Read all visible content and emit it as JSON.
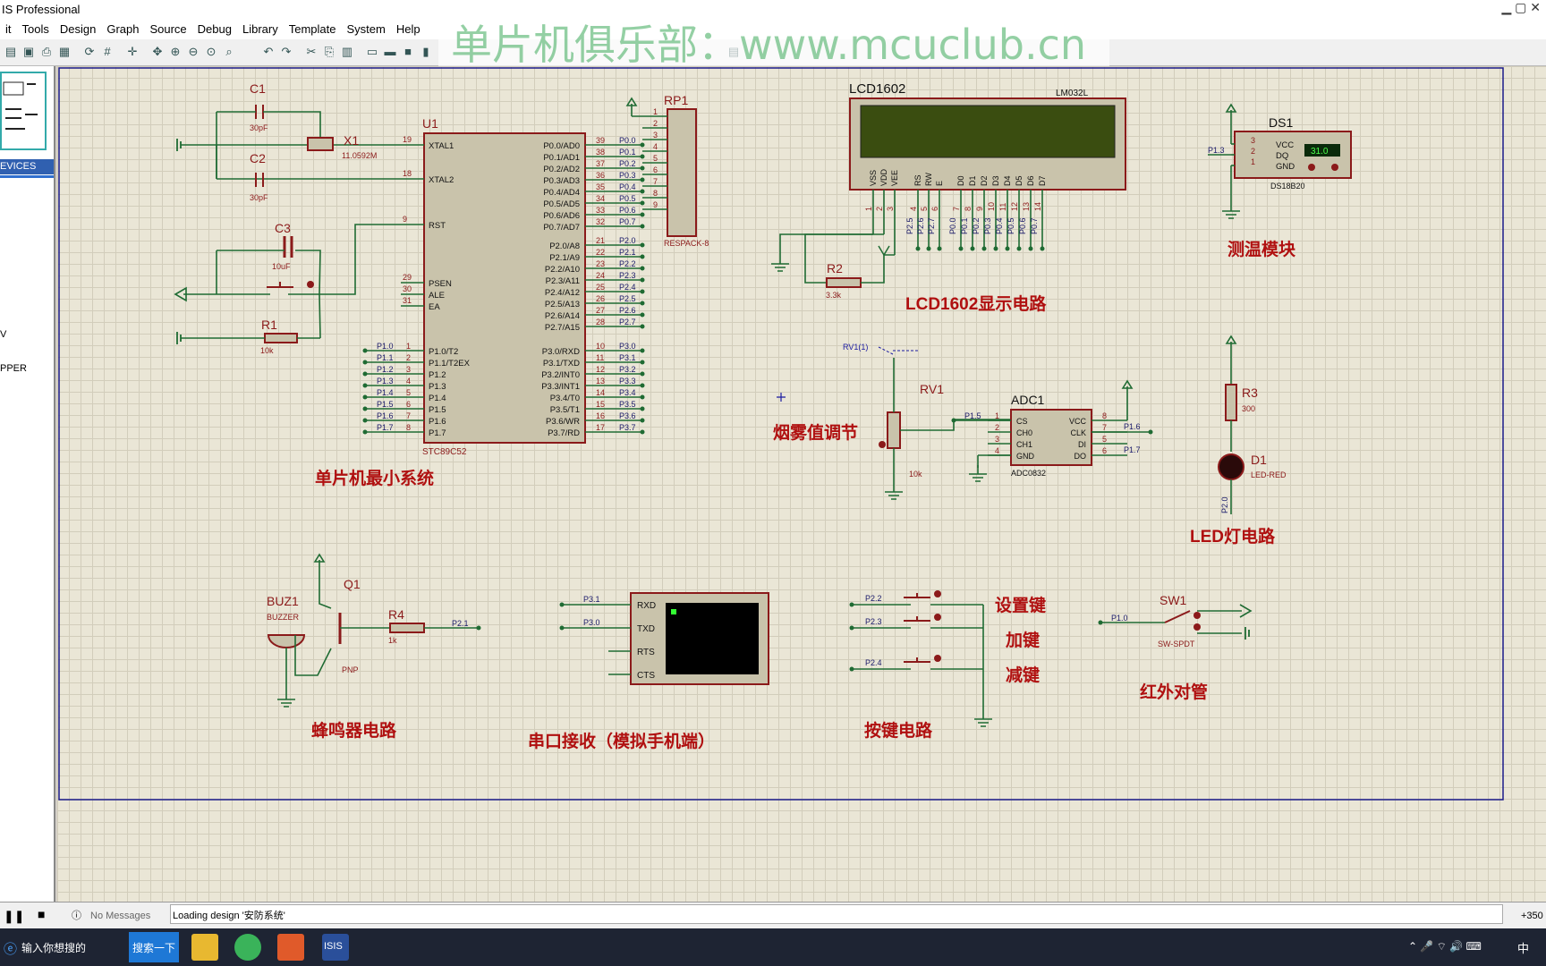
{
  "window": {
    "title": "IS Professional"
  },
  "menu": [
    "it",
    "Tools",
    "Design",
    "Graph",
    "Source",
    "Debug",
    "Library",
    "Template",
    "System",
    "Help"
  ],
  "watermark": "单片机俱乐部：www.mcuclub.cn",
  "sidebar": {
    "label_devices": "EVICES",
    "item_v": "V",
    "item_pper": "PPER"
  },
  "schematic": {
    "u1": "U1",
    "u1_part": "STC89C52",
    "u1_left_pins": [
      {
        "n": "19",
        "name": "XTAL1"
      },
      {
        "n": "18",
        "name": "XTAL2"
      },
      {
        "n": "9",
        "name": "RST"
      },
      {
        "n": "29",
        "name": "PSEN"
      },
      {
        "n": "30",
        "name": "ALE"
      },
      {
        "n": "31",
        "name": "EA"
      }
    ],
    "u1_p1_pins": [
      {
        "n": "1",
        "net": "P1.0",
        "name": "P1.0/T2"
      },
      {
        "n": "2",
        "net": "P1.1",
        "name": "P1.1/T2EX"
      },
      {
        "n": "3",
        "net": "P1.2",
        "name": "P1.2"
      },
      {
        "n": "4",
        "net": "P1.3",
        "name": "P1.3"
      },
      {
        "n": "5",
        "net": "P1.4",
        "name": "P1.4"
      },
      {
        "n": "6",
        "net": "P1.5",
        "name": "P1.5"
      },
      {
        "n": "7",
        "net": "P1.6",
        "name": "P1.6"
      },
      {
        "n": "8",
        "net": "P1.7",
        "name": "P1.7"
      }
    ],
    "u1_p0_pins": [
      {
        "n": "39",
        "name": "P0.0/AD0",
        "net": "P0.0"
      },
      {
        "n": "38",
        "name": "P0.1/AD1",
        "net": "P0.1"
      },
      {
        "n": "37",
        "name": "P0.2/AD2",
        "net": "P0.2"
      },
      {
        "n": "36",
        "name": "P0.3/AD3",
        "net": "P0.3"
      },
      {
        "n": "35",
        "name": "P0.4/AD4",
        "net": "P0.4"
      },
      {
        "n": "34",
        "name": "P0.5/AD5",
        "net": "P0.5"
      },
      {
        "n": "33",
        "name": "P0.6/AD6",
        "net": "P0.6"
      },
      {
        "n": "32",
        "name": "P0.7/AD7",
        "net": "P0.7"
      }
    ],
    "u1_p2_pins": [
      {
        "n": "21",
        "name": "P2.0/A8",
        "net": "P2.0"
      },
      {
        "n": "22",
        "name": "P2.1/A9",
        "net": "P2.1"
      },
      {
        "n": "23",
        "name": "P2.2/A10",
        "net": "P2.2"
      },
      {
        "n": "24",
        "name": "P2.3/A11",
        "net": "P2.3"
      },
      {
        "n": "25",
        "name": "P2.4/A12",
        "net": "P2.4"
      },
      {
        "n": "26",
        "name": "P2.5/A13",
        "net": "P2.5"
      },
      {
        "n": "27",
        "name": "P2.6/A14",
        "net": "P2.6"
      },
      {
        "n": "28",
        "name": "P2.7/A15",
        "net": "P2.7"
      }
    ],
    "u1_p3_pins": [
      {
        "n": "10",
        "name": "P3.0/RXD",
        "net": "P3.0"
      },
      {
        "n": "11",
        "name": "P3.1/TXD",
        "net": "P3.1"
      },
      {
        "n": "12",
        "name": "P3.2/INT0",
        "net": "P3.2"
      },
      {
        "n": "13",
        "name": "P3.3/INT1",
        "net": "P3.3"
      },
      {
        "n": "14",
        "name": "P3.4/T0",
        "net": "P3.4"
      },
      {
        "n": "15",
        "name": "P3.5/T1",
        "net": "P3.5"
      },
      {
        "n": "16",
        "name": "P3.6/WR",
        "net": "P3.6"
      },
      {
        "n": "17",
        "name": "P3.7/RD",
        "net": "P3.7"
      }
    ],
    "c1": "C1",
    "c1_val": "30pF",
    "c2": "C2",
    "c2_val": "30pF",
    "x1": "X1",
    "x1_val": "11.0592M",
    "c3": "C3",
    "c3_val": "10uF",
    "r1": "R1",
    "r1_val": "10k",
    "rp1": "RP1",
    "rp1_part": "RESPACK-8",
    "rp1_pins": [
      "1",
      "2",
      "3",
      "4",
      "5",
      "6",
      "7",
      "8",
      "9"
    ],
    "lcd": "LCD1602",
    "lcd_part": "LM032L",
    "lcd_pins": [
      "VSS",
      "VDD",
      "VEE",
      "RS",
      "RW",
      "E",
      "D0",
      "D1",
      "D2",
      "D3",
      "D4",
      "D5",
      "D6",
      "D7"
    ],
    "lcd_pin_nums": [
      "1",
      "2",
      "3",
      "4",
      "5",
      "6",
      "7",
      "8",
      "9",
      "10",
      "11",
      "12",
      "13",
      "14"
    ],
    "lcd_nets": [
      "P2.5",
      "P2.6",
      "P2.7",
      "P0.0",
      "P0.1",
      "P0.2",
      "P0.3",
      "P0.4",
      "P0.5",
      "P0.6",
      "P0.7"
    ],
    "r2": "R2",
    "r2_val": "3.3k",
    "ds1": "DS1",
    "ds1_part": "DS18B20",
    "ds1_reading": "31.0",
    "ds1_net": "P1.3",
    "ds1_pins": [
      "VCC",
      "DQ",
      "GND"
    ],
    "ds1_nums": [
      "3",
      "2",
      "1"
    ],
    "rv1": "RV1",
    "rv1_val": "10k",
    "rv1_probe": "RV1(1)",
    "adc": "ADC1",
    "adc_part": "ADC0832",
    "adc_left": [
      "CS",
      "CH0",
      "CH1",
      "GND"
    ],
    "adc_right": [
      "VCC",
      "CLK",
      "DI",
      "DO"
    ],
    "adc_lnums": [
      "1",
      "2",
      "3",
      "4"
    ],
    "adc_rnums": [
      "8",
      "7",
      "5",
      "6"
    ],
    "adc_nets": [
      "P1.5",
      "P1.6",
      "P1.7"
    ],
    "r3": "R3",
    "r3_val": "300",
    "d1": "D1",
    "d1_part": "LED-RED",
    "d1_net": "P2.0",
    "buz": "BUZ1",
    "buz_part": "BUZZER",
    "q1": "Q1",
    "q1_part": "PNP",
    "r4": "R4",
    "r4_val": "1k",
    "r4_net": "P2.1",
    "serial_nets": [
      "P3.1",
      "P3.0"
    ],
    "serial_pins": [
      "RXD",
      "TXD",
      "RTS",
      "CTS"
    ],
    "keys_nets": [
      "P2.2",
      "P2.3",
      "P2.4"
    ],
    "sw1": "SW1",
    "sw1_part": "SW-SPDT",
    "sw1_net": "P1.0",
    "labels": {
      "mcu": "单片机最小系统",
      "lcd": "LCD1602显示电路",
      "temp": "测温模块",
      "smoke": "烟雾值调节",
      "led": "LED灯电路",
      "buzzer": "蜂鸣器电路",
      "serial": "串口接收（模拟手机端）",
      "keys": "按键电路",
      "set": "设置键",
      "add": "加键",
      "sub": "减键",
      "ir": "红外对管"
    }
  },
  "status": {
    "messages": "No Messages",
    "text": "Loading design '安防系统'",
    "coord": "+350"
  },
  "taskbar": {
    "search_placeholder": "输入你想搜的",
    "search_button": "搜索一下",
    "ime": "中"
  },
  "colors": {
    "wire": "#1f6b33",
    "comp": "#8b1a1a",
    "fill": "#c9c3ab",
    "label": "#b01010",
    "pin": "#1a1a6a"
  }
}
